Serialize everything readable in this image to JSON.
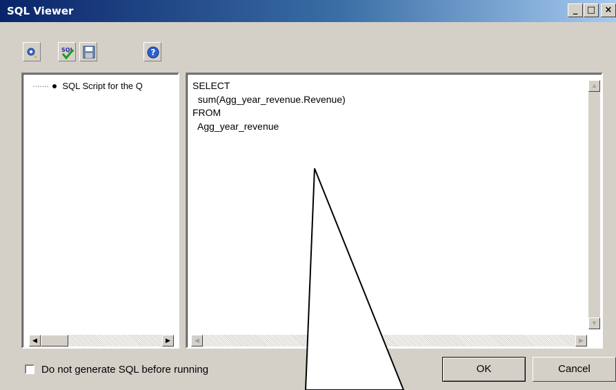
{
  "window": {
    "title": "SQL Viewer",
    "minimize_glyph": "_",
    "maximize_glyph": "□",
    "close_glyph": "×"
  },
  "toolbar": {
    "buttons": [
      {
        "name": "generate-icon"
      },
      {
        "name": "validate-sql-icon"
      },
      {
        "name": "save-icon"
      },
      {
        "name": "help-icon"
      }
    ]
  },
  "tree": {
    "item_label": "SQL Script for the Q"
  },
  "sql": {
    "lines": [
      "SELECT",
      "  sum(Agg_year_revenue.Revenue)",
      "FROM",
      "  Agg_year_revenue"
    ]
  },
  "scroll": {
    "left": "◀",
    "right": "▶",
    "up": "▲",
    "down": "▼"
  },
  "options": {
    "checkbox_label": "Do not generate SQL before running",
    "checked": false
  },
  "buttons": {
    "ok": "OK",
    "cancel": "Cancel"
  }
}
